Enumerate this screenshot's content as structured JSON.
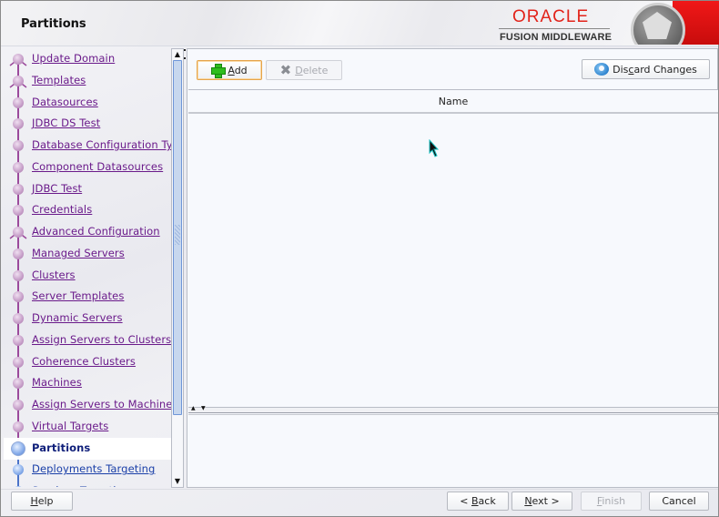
{
  "window": {
    "title": "Partitions"
  },
  "brand": {
    "name": "ORACLE",
    "product": "FUSION MIDDLEWARE",
    "accent_color": "#e2231a"
  },
  "sidebar": {
    "items": [
      {
        "label": "Update Domain",
        "state": "done",
        "icon": "fork-node-icon"
      },
      {
        "label": "Templates",
        "state": "done",
        "icon": "fork-node-icon"
      },
      {
        "label": "Datasources",
        "state": "done",
        "icon": "step-node-icon"
      },
      {
        "label": "JDBC DS Test",
        "state": "done",
        "icon": "step-node-icon"
      },
      {
        "label": "Database Configuration Type",
        "state": "done",
        "icon": "step-node-icon"
      },
      {
        "label": "Component Datasources",
        "state": "done",
        "icon": "step-node-icon"
      },
      {
        "label": "JDBC Test",
        "state": "done",
        "icon": "step-node-icon"
      },
      {
        "label": "Credentials",
        "state": "done",
        "icon": "step-node-icon"
      },
      {
        "label": "Advanced Configuration",
        "state": "done",
        "icon": "fork-node-icon"
      },
      {
        "label": "Managed Servers",
        "state": "done",
        "icon": "step-node-icon"
      },
      {
        "label": "Clusters",
        "state": "done",
        "icon": "step-node-icon"
      },
      {
        "label": "Server Templates",
        "state": "done",
        "icon": "step-node-icon"
      },
      {
        "label": "Dynamic Servers",
        "state": "done",
        "icon": "step-node-icon"
      },
      {
        "label": "Assign Servers to Clusters",
        "state": "done",
        "icon": "step-node-icon"
      },
      {
        "label": "Coherence Clusters",
        "state": "done",
        "icon": "step-node-icon"
      },
      {
        "label": "Machines",
        "state": "done",
        "icon": "step-node-icon"
      },
      {
        "label": "Assign Servers to Machines",
        "state": "done",
        "icon": "step-node-icon"
      },
      {
        "label": "Virtual Targets",
        "state": "done",
        "icon": "step-node-icon"
      },
      {
        "label": "Partitions",
        "state": "current",
        "icon": "current-step-icon"
      },
      {
        "label": "Deployments Targeting",
        "state": "pending",
        "icon": "step-node-icon"
      },
      {
        "label": "Services Targeting",
        "state": "pending",
        "icon": "step-node-icon"
      }
    ]
  },
  "toolbar": {
    "add_label": "Add",
    "add_mnemonic": "A",
    "delete_label": "Delete",
    "delete_mnemonic": "D",
    "discard_label": "Discard Changes",
    "discard_mnemonic": "c"
  },
  "table": {
    "columns": [
      "Name"
    ],
    "rows": []
  },
  "footer": {
    "help_label": "Help",
    "back_label": "< Back",
    "next_label": "Next >",
    "finish_label": "Finish",
    "cancel_label": "Cancel"
  }
}
